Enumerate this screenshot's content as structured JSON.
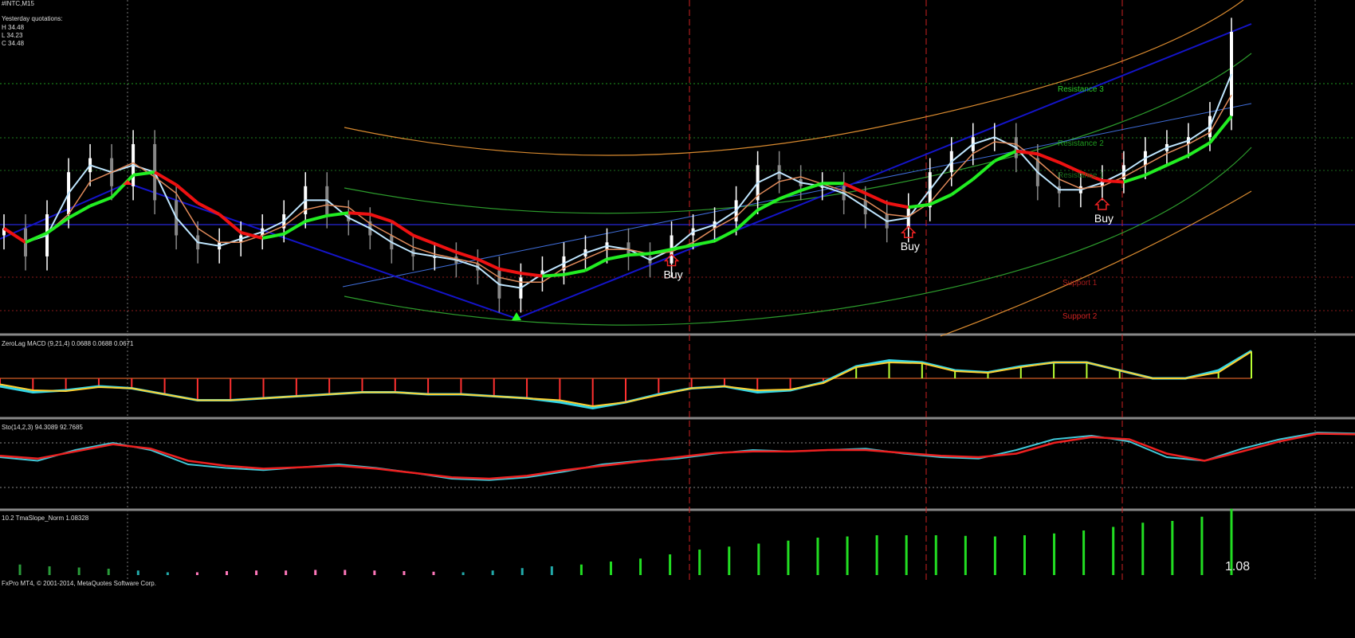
{
  "header": {
    "symbol_title": "#INTC,M15",
    "yesterday_label": "Yesterday quotations:",
    "high": "H 34.48",
    "low": "L 34.23",
    "close": "C 34.48"
  },
  "levels": {
    "resistance_3": "Resistance 3",
    "resistance_2": "Resistance 2",
    "resistance_1": "Resistance 1",
    "support_1": "Support 1",
    "support_2": "Support 2"
  },
  "signals": [
    {
      "label": "Buy",
      "bar_index": 31
    },
    {
      "label": "Buy",
      "bar_index": 42
    },
    {
      "label": "Buy",
      "bar_index": 51
    }
  ],
  "indicators": {
    "macd_title": "ZeroLag MACD (9,21,4) 0.0688 0.0688 0.0671",
    "sto_title": "Sto(14,2,3) 94.3089 92.7685",
    "tma_title": "10.2 TmaSlope_Norm 1.08328",
    "tma_value_readout": "1.08"
  },
  "footer": {
    "copyright": "FxPro MT4, © 2001-2014, MetaQuotes Software Corp."
  },
  "colors": {
    "background": "#000000",
    "bull_candle": "#ffffff",
    "bear_candle": "#888888",
    "ma_up": "#22ee22",
    "ma_down": "#ee1111",
    "blue_line": "#1010cc",
    "signal_line": "#cc2222",
    "macd_main": "#33d6e6",
    "macd_signal": "#ffd030",
    "hist_pos": "#b9ff33",
    "hist_neg": "#ff3030",
    "sto_main": "#40c8d8",
    "sto_signal": "#ee2020",
    "tma_pos": "#22dd22",
    "tma_neg": "#ff77bb",
    "tma_mid": "#22aaaa"
  },
  "chart_data": {
    "type": "candlestick",
    "timeframe": "M15",
    "closes": [
      34.34,
      34.3,
      34.36,
      34.42,
      34.44,
      34.4,
      34.46,
      34.38,
      34.33,
      34.31,
      34.32,
      34.33,
      34.34,
      34.36,
      34.4,
      34.36,
      34.35,
      34.33,
      34.31,
      34.3,
      34.3,
      34.29,
      34.28,
      34.24,
      34.27,
      34.28,
      34.3,
      34.31,
      34.32,
      34.3,
      34.29,
      34.33,
      34.34,
      34.35,
      34.38,
      34.43,
      34.41,
      34.4,
      34.4,
      34.38,
      34.36,
      34.34,
      34.37,
      34.42,
      34.45,
      34.47,
      34.47,
      34.44,
      34.4,
      34.39,
      34.4,
      34.41,
      34.43,
      34.45,
      34.46,
      34.47,
      34.5,
      34.62
    ],
    "macd": {
      "main": [
        -0.02,
        -0.035,
        -0.03,
        -0.02,
        -0.025,
        -0.04,
        -0.055,
        -0.055,
        -0.05,
        -0.045,
        -0.04,
        -0.035,
        -0.035,
        -0.04,
        -0.04,
        -0.045,
        -0.05,
        -0.06,
        -0.075,
        -0.06,
        -0.04,
        -0.025,
        -0.02,
        -0.035,
        -0.03,
        -0.01,
        0.03,
        0.045,
        0.04,
        0.02,
        0.015,
        0.03,
        0.04,
        0.04,
        0.02,
        0.0,
        0.0,
        0.02,
        0.0688
      ],
      "signal": [
        -0.015,
        -0.03,
        -0.032,
        -0.022,
        -0.025,
        -0.04,
        -0.055,
        -0.055,
        -0.05,
        -0.045,
        -0.04,
        -0.035,
        -0.035,
        -0.04,
        -0.04,
        -0.045,
        -0.05,
        -0.055,
        -0.07,
        -0.06,
        -0.042,
        -0.025,
        -0.02,
        -0.03,
        -0.028,
        -0.012,
        0.028,
        0.04,
        0.038,
        0.018,
        0.014,
        0.028,
        0.04,
        0.04,
        0.02,
        0.0,
        0.0,
        0.015,
        0.0671
      ]
    },
    "stochastic": {
      "levels": [
        80,
        20
      ],
      "main": [
        60,
        55,
        70,
        80,
        70,
        50,
        45,
        42,
        46,
        50,
        45,
        38,
        30,
        28,
        32,
        40,
        50,
        55,
        58,
        65,
        70,
        68,
        70,
        72,
        65,
        60,
        58,
        70,
        85,
        90,
        82,
        60,
        55,
        72,
        85,
        94.3089,
        93
      ],
      "signal": [
        62,
        58,
        68,
        78,
        72,
        55,
        48,
        44,
        46,
        48,
        44,
        38,
        32,
        30,
        34,
        42,
        48,
        54,
        60,
        66,
        68,
        68,
        70,
        70,
        66,
        62,
        60,
        65,
        80,
        88,
        85,
        65,
        55,
        68,
        82,
        92.7685,
        92
      ]
    },
    "tma_slope": {
      "values": [
        0.15,
        0.12,
        0.1,
        0.08,
        0.05,
        0.02,
        -0.02,
        -0.04,
        -0.05,
        -0.05,
        -0.06,
        -0.06,
        -0.05,
        -0.04,
        -0.03,
        0.02,
        0.05,
        0.09,
        0.12,
        0.15,
        0.2,
        0.25,
        0.32,
        0.4,
        0.45,
        0.5,
        0.55,
        0.6,
        0.62,
        0.64,
        0.64,
        0.64,
        0.63,
        0.62,
        0.64,
        0.67,
        0.72,
        0.78,
        0.85,
        0.88,
        0.95,
        1.08328
      ]
    }
  }
}
